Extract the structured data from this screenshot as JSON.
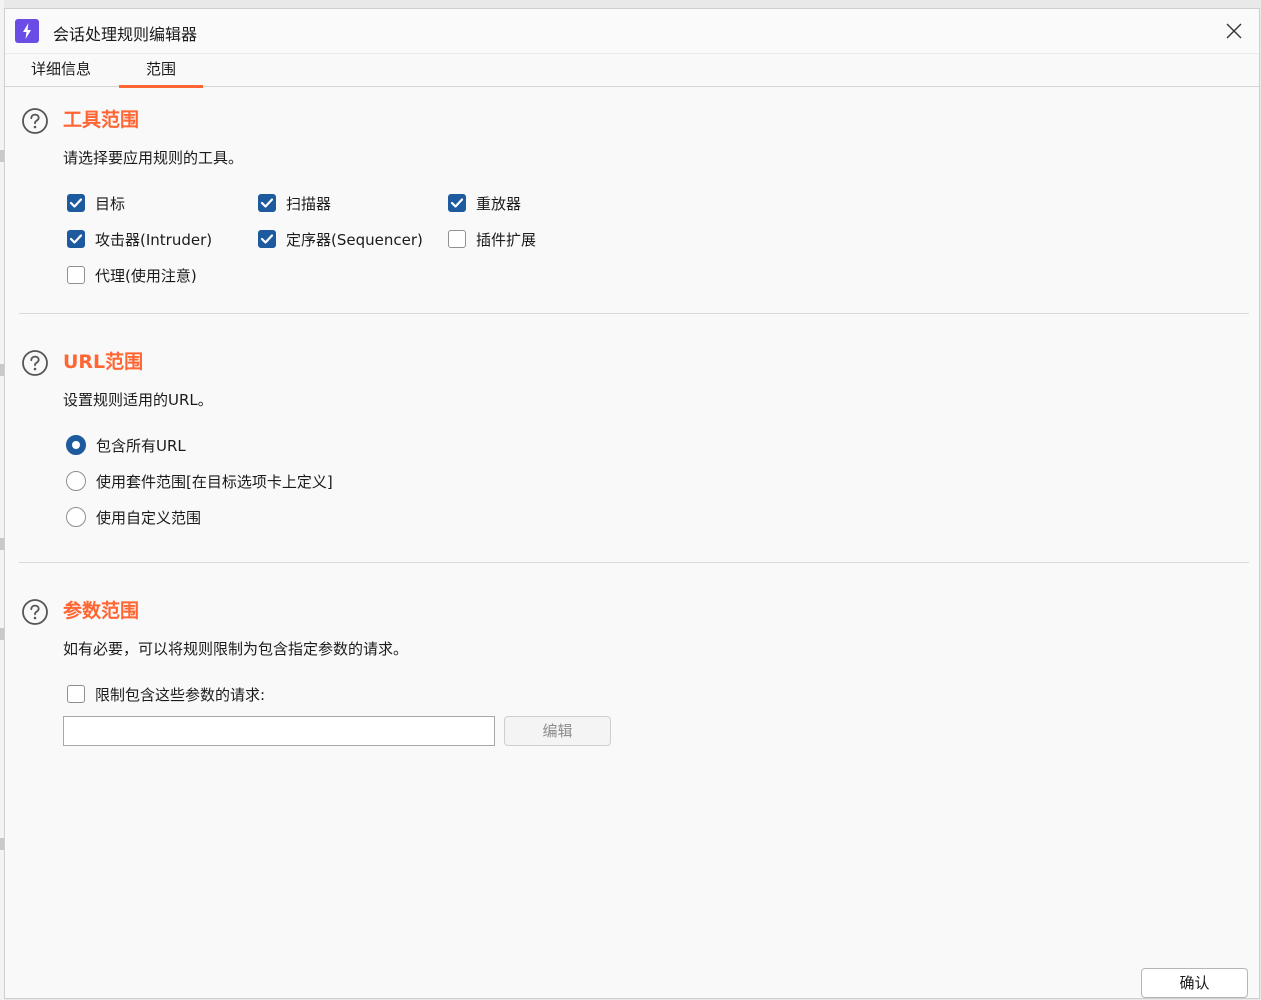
{
  "window": {
    "title": "会话处理规则编辑器"
  },
  "tabs": [
    {
      "label": "详细信息",
      "active": false
    },
    {
      "label": "范围",
      "active": true
    }
  ],
  "tool_scope": {
    "title": "工具范围",
    "description": "请选择要应用规则的工具。",
    "options": [
      {
        "label": "目标",
        "checked": true
      },
      {
        "label": "扫描器",
        "checked": true
      },
      {
        "label": "重放器",
        "checked": true
      },
      {
        "label": "攻击器(Intruder)",
        "checked": true
      },
      {
        "label": "定序器(Sequencer)",
        "checked": true
      },
      {
        "label": "插件扩展",
        "checked": false
      },
      {
        "label": "代理(使用注意)",
        "checked": false
      }
    ]
  },
  "url_scope": {
    "title": "URL范围",
    "description": "设置规则适用的URL。",
    "options": [
      {
        "label": "包含所有URL",
        "selected": true
      },
      {
        "label": "使用套件范围[在目标选项卡上定义]",
        "selected": false
      },
      {
        "label": "使用自定义范围",
        "selected": false
      }
    ]
  },
  "param_scope": {
    "title": "参数范围",
    "description": "如有必要，可以将规则限制为包含指定参数的请求。",
    "checkbox_label": "限制包含这些参数的请求:",
    "checked": false,
    "input_value": "",
    "edit_label": "编辑"
  },
  "footer": {
    "ok_label": "确认"
  },
  "colors": {
    "accent": "#ff6633",
    "check": "#1d5a9e",
    "app_icon": "#6b4de6"
  }
}
